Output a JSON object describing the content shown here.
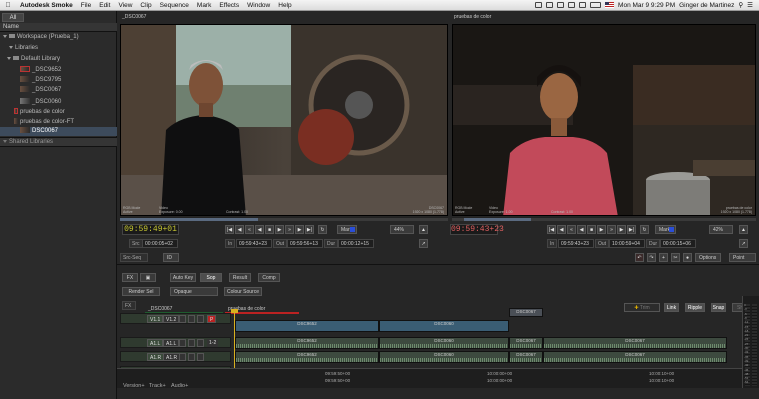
{
  "menubar": {
    "app_name": "Autodesk Smoke",
    "items": [
      "File",
      "Edit",
      "View",
      "Clip",
      "Sequence",
      "Mark",
      "Effects",
      "Window",
      "Help"
    ],
    "clock": "Mon Mar 9  9:29 PM",
    "user": "Ginger de Martinez"
  },
  "sidebar": {
    "tab": "All",
    "header": "Name",
    "workspace": "Workspace (Prueba_1)",
    "libraries": "Libraries",
    "default_library": "Default Library",
    "items": [
      "_DSC9652",
      "_DSC9795",
      "_DSC0067",
      "_DSC0060",
      "pruebas de color",
      "pruebas de color-FT",
      "DSC0067"
    ],
    "shared_libraries": "Shared Libraries"
  },
  "viewer_left": {
    "title": "_DSC0067",
    "info_l1": "RGB Mode",
    "info_l2": "Active",
    "info_mid1": "Video",
    "info_mid2": "Exposure: 0.00",
    "info_mid3": "Contrast: 1.00",
    "info_r1": "DSC0067",
    "info_r2": "1920 x 1080 (1.778)",
    "timecode": "09:59:49+01",
    "mark": "Mark",
    "zoom": "44%",
    "src_label": "Src",
    "src_value": "00:00:05+02",
    "in_label": "In",
    "in_value": "09:59:43+23",
    "out_label": "Out",
    "out_value": "09:59:56+13",
    "dur_label": "Dur",
    "dur_value": "00:00:12+15"
  },
  "viewer_right": {
    "title": "pruebas de color",
    "info_l1": "RGB Mode",
    "info_l2": "Active",
    "info_mid1": "Video",
    "info_mid2": "Exposure: 1.00",
    "info_mid3": "Contrast: 1.00",
    "info_r1": "pruebas de color",
    "info_r2": "1920 x 1080 (1.778)",
    "timecode": "09:59:43+23",
    "mark": "Mark",
    "zoom": "42%",
    "in_label": "In",
    "in_value": "09:59:43+23",
    "out_label": "Out",
    "out_value": "10:00:59+04",
    "dur_label": "Dur",
    "dur_value": "00:00:15+06"
  },
  "controls": {
    "src_seq": "Src-Seq",
    "id_label": "ID",
    "options": "Options",
    "point": "Point",
    "fx": "FX",
    "auto_key": "Auto Key",
    "sop": "Sop",
    "result": "Result",
    "comp": "Comp",
    "render_sel": "Render Sel",
    "opaque": "Opaque",
    "colour_source": "Colour Source",
    "fx2": "FX"
  },
  "sequence_tabs": [
    "_DSC0067",
    "pruebas de color"
  ],
  "timeline": {
    "trim": "Trim",
    "link": "Link",
    "ripple": "Ripple",
    "snap": "Snap",
    "shift": "Shift",
    "tracks": [
      {
        "id": "V1.1",
        "sub": "V1.2",
        "badge": "P"
      },
      {
        "id": "A1.L",
        "sub": "A1.L",
        "badge": "1-2"
      },
      {
        "id": "A1.R",
        "sub": "A1.R",
        "badge": ""
      },
      {
        "id": "A2.L",
        "sub": "A2.L",
        "badge": ""
      }
    ],
    "video_clips": [
      "DSC9652",
      "DSC0060",
      "DSC0067"
    ],
    "audio_clips": [
      "DSC9652",
      "DSC0060",
      "DSC0067",
      "DSC0067"
    ],
    "ruler_labels": [
      {
        "top": "09:59:50+00",
        "bottom": "09:59:50+00"
      },
      {
        "top": "10:00:00+00",
        "bottom": "10:00:00+00"
      },
      {
        "top": "10:00:10+00",
        "bottom": "10:00:10+00"
      }
    ],
    "footer": [
      "Version+",
      "Track+",
      "Audio+"
    ],
    "meter_ticks": [
      "0",
      "-3",
      "-6",
      "-9",
      "-12",
      "-15",
      "-18",
      "-21",
      "-24",
      "-27",
      "-30",
      "-33",
      "-36",
      "-39",
      "-42",
      "-45",
      "-48",
      "-51",
      "-54"
    ]
  }
}
